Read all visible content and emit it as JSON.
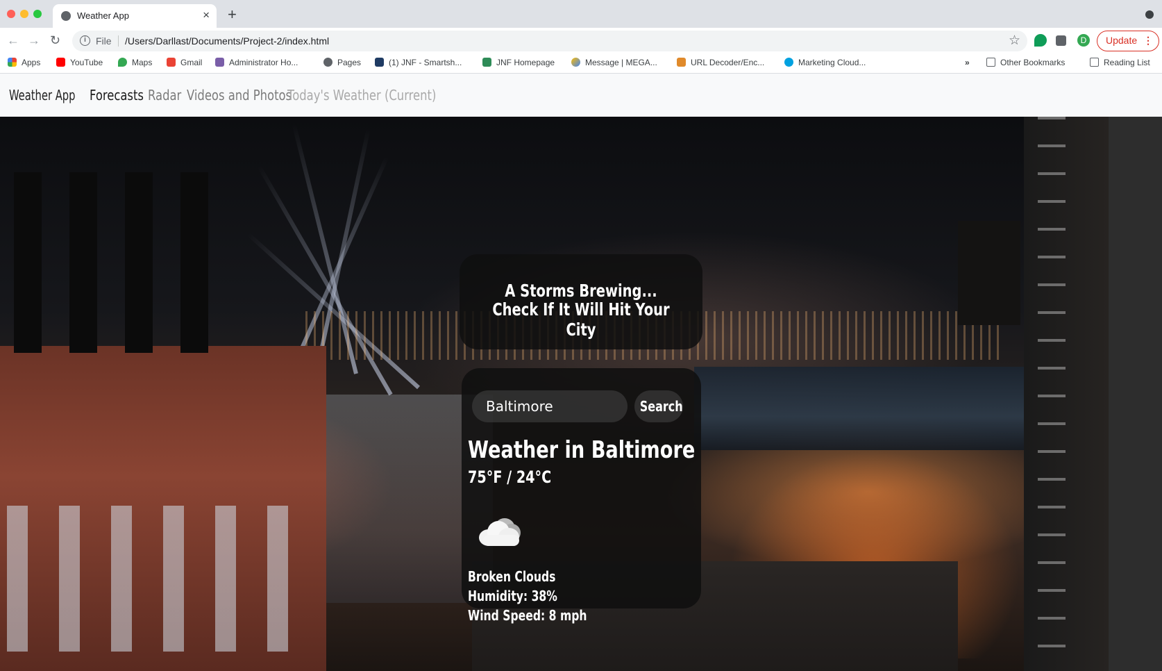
{
  "browser": {
    "tab_title": "Weather App",
    "url_scheme": "File",
    "url": "/Users/Darllast/Documents/Project-2/index.html",
    "update_label": "Update",
    "profile_initial": "D",
    "bookmarks": [
      {
        "label": "Apps",
        "icon": "apps-grid-icon"
      },
      {
        "label": "YouTube",
        "icon": "youtube-icon"
      },
      {
        "label": "Maps",
        "icon": "maps-pin-icon"
      },
      {
        "label": "Gmail",
        "icon": "gmail-icon"
      },
      {
        "label": "Administrator Ho...",
        "icon": "admin-icon"
      },
      {
        "label": "Pages",
        "icon": "globe-icon"
      },
      {
        "label": "(1) JNF - Smartsh...",
        "icon": "smartsheet-icon"
      },
      {
        "label": "JNF Homepage",
        "icon": "shield-icon"
      },
      {
        "label": "Message | MEGA...",
        "icon": "mega-icon"
      },
      {
        "label": "URL Decoder/Enc...",
        "icon": "decoder-icon"
      },
      {
        "label": "Marketing Cloud...",
        "icon": "cloud-icon"
      }
    ],
    "more_bookmarks": "»",
    "other_bookmarks": "Other Bookmarks",
    "reading_list": "Reading List"
  },
  "site": {
    "brand": "Weather App",
    "nav": [
      {
        "label": "Forecasts",
        "state": "active"
      },
      {
        "label": "Radar",
        "state": "normal"
      },
      {
        "label": "Videos and Photos",
        "state": "normal"
      },
      {
        "label": "Today's Weather (Current)",
        "state": "disabled"
      }
    ]
  },
  "hero": {
    "headline_line1": "A Storms Brewing...",
    "headline_line2": "Check If It Will Hit Your City"
  },
  "search": {
    "value": "Baltimore",
    "button_label": "Search"
  },
  "weather": {
    "title": "Weather in Baltimore",
    "temperature": "75°F / 24°C",
    "condition_icon": "broken-clouds-icon",
    "description": "Broken Clouds",
    "humidity": "Humidity: 38%",
    "wind": "Wind Speed: 8 mph"
  },
  "colors": {
    "accent_update": "#d93025",
    "nav_active": "#1a1a1a",
    "nav_normal": "#7b7b7b",
    "nav_disabled": "#a9a9a9"
  }
}
